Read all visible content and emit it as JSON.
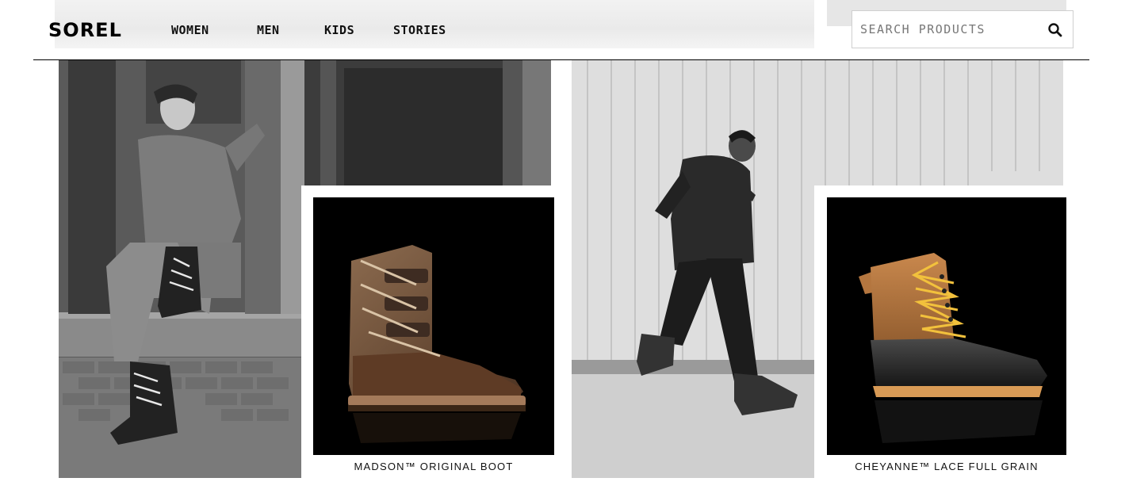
{
  "brand": {
    "logo_text": "SOREL"
  },
  "nav": {
    "items": [
      {
        "label": "WOMEN"
      },
      {
        "label": "MEN"
      },
      {
        "label": "KIDS"
      },
      {
        "label": "STORIES"
      }
    ]
  },
  "search": {
    "placeholder": "SEARCH PRODUCTS",
    "value": "",
    "icon": "search-icon"
  },
  "products": [
    {
      "name": "MADSON™ ORIGINAL BOOT"
    },
    {
      "name": "CHEYANNE™ LACE FULL GRAIN"
    }
  ],
  "colors": {
    "text": "#111111",
    "product_bg": "#000000",
    "divider": "#000000"
  }
}
